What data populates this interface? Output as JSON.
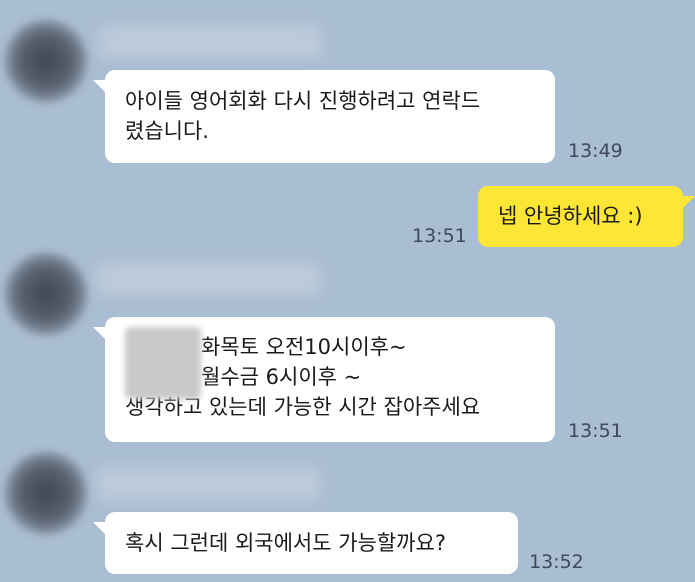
{
  "messages": [
    {
      "id": "m1",
      "direction": "incoming",
      "lines": [
        "아이들 영어회화 다시 진행하려고 연락드",
        "렸습니다."
      ],
      "time": "13:49"
    },
    {
      "id": "m2",
      "direction": "outgoing",
      "lines": [
        "넵 안녕하세요 :)"
      ],
      "time": "13:51"
    },
    {
      "id": "m3",
      "direction": "incoming",
      "lines": [
        "화목토 오전10시이후~",
        "월수금 6시이후 ~",
        "생각하고 있는데 가능한 시간 잡아주세요"
      ],
      "time": "13:51"
    },
    {
      "id": "m4",
      "direction": "incoming",
      "lines": [
        "혹시 그런데 외국에서도 가능할까요?"
      ],
      "time": "13:52"
    }
  ],
  "colors": {
    "background": "#a9bdd3",
    "incoming_bubble": "#ffffff",
    "outgoing_bubble": "#fde635",
    "time_text": "#3e4a58"
  }
}
